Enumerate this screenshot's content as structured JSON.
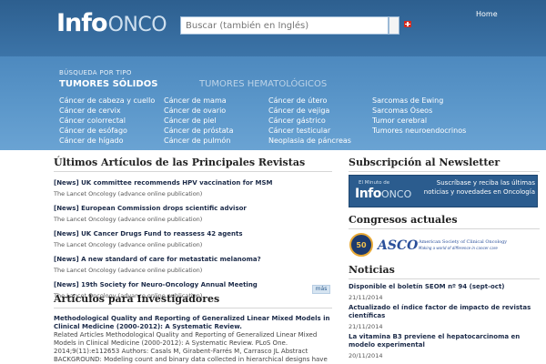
{
  "header": {
    "logo_info": "Info",
    "logo_onco": "ONCO",
    "search_placeholder": "Buscar (también en Inglés)",
    "home": "Home",
    "search_type": "BÚSQUEDA POR TIPO",
    "tab_solid": "TUMORES SÓLIDOS",
    "tab_hema": "TUMORES HEMATOLÓGICOS"
  },
  "cancer_columns": [
    [
      "Cáncer de cabeza y cuello",
      "Cáncer de cervix",
      "Cáncer colorrectal",
      "Cáncer de esófago",
      "Cáncer de hígado"
    ],
    [
      "Cáncer de mama",
      "Cáncer de ovario",
      "Cáncer de piel",
      "Cáncer de próstata",
      "Cáncer de pulmón"
    ],
    [
      "Cáncer de útero",
      "Cáncer de vejiga",
      "Cáncer gástrico",
      "Cáncer testicular",
      "Neoplasia de páncreas"
    ],
    [
      "Sarcomas de Ewing",
      "Sarcomas Óseos",
      "Tumor cerebral",
      "Tumores neuroendocrinos"
    ]
  ],
  "latest": {
    "title": "Últimos Artículos de las Principales Revistas",
    "items": [
      {
        "title": "[News] UK committee recommends HPV vaccination for MSM",
        "source": "The Lancet Oncology (advance online publication)"
      },
      {
        "title": "[News] European Commission drops scientific advisor",
        "source": "The Lancet Oncology (advance online publication)"
      },
      {
        "title": "[News] UK Cancer Drugs Fund to reassess 42 agents",
        "source": "The Lancet Oncology (advance online publication)"
      },
      {
        "title": "[News] A new standard of care for metastatic melanoma?",
        "source": "The Lancet Oncology (advance online publication)"
      },
      {
        "title": "[News] 19th Society for Neuro-Oncology Annual Meeting",
        "source": "The Lancet Oncology (advance online publication)"
      }
    ],
    "more": "más"
  },
  "researchers": {
    "title": "Artículos para Investigadores",
    "paper_title": "Methodological Quality and Reporting of Generalized Linear Mixed Models in Clinical Medicine (2000-2012): A Systematic Review.",
    "paper_body": "Related Articles Methodological Quality and Reporting of Generalized Linear Mixed Models in Clinical Medicine (2000-2012): A Systematic Review. PLoS One. 2014;9(11):e112653 Authors: Casals M, Girabent-Farrés M, Carrasco JL Abstract BACKGROUND: Modeling count and binary data collected in hierarchical designs have increased the use of"
  },
  "newsletter": {
    "title": "Subscripción al Newsletter",
    "minuto": "El Minuto de",
    "info": "Info",
    "onco": "ONCO",
    "text": "Suscríbase y reciba las últimas noticias y novedades en Oncología"
  },
  "congresos": {
    "title": "Congresos actuales",
    "badge": "50",
    "asco": "ASCO",
    "asco_name": "American Society of Clinical Oncology",
    "asco_tag": "Making a world of difference in cancer care"
  },
  "noticias": {
    "title": "Noticias",
    "items": [
      {
        "title": "Disponible el boletín SEOM nº 94 (sept-oct)",
        "date": "21/11/2014"
      },
      {
        "title": "Actualizado el índice factor de impacto de revistas científicas",
        "date": "21/11/2014"
      },
      {
        "title": "La vitamina B3 previene el hepatocarcinoma en modelo experimental",
        "date": "20/11/2014"
      }
    ]
  }
}
